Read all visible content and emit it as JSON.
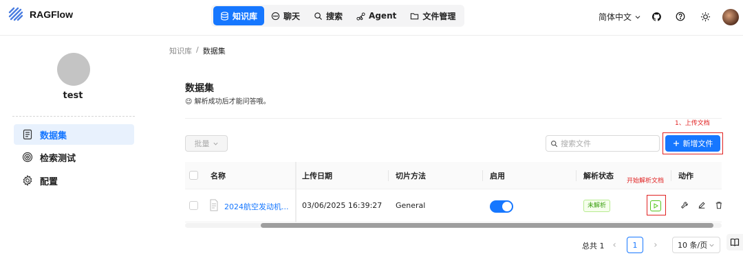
{
  "app": {
    "name": "RAGFlow"
  },
  "nav": {
    "items": [
      {
        "label": "知识库",
        "icon": "database-icon",
        "active": true
      },
      {
        "label": "聊天",
        "icon": "chat-icon",
        "active": false
      },
      {
        "label": "搜索",
        "icon": "search-icon",
        "active": false
      },
      {
        "label": "Agent",
        "icon": "agent-graph-icon",
        "active": false
      },
      {
        "label": "文件管理",
        "icon": "folder-icon",
        "active": false
      }
    ]
  },
  "header": {
    "language": "简体中文"
  },
  "profile": {
    "name": "test"
  },
  "sidebar": {
    "items": [
      {
        "label": "数据集",
        "icon": "document-icon",
        "active": true
      },
      {
        "label": "检索测试",
        "icon": "target-icon",
        "active": false
      },
      {
        "label": "配置",
        "icon": "gear-icon",
        "active": false
      }
    ]
  },
  "breadcrumb": {
    "root": "知识库",
    "separator": "/",
    "current": "数据集"
  },
  "page": {
    "title": "数据集",
    "description": "😉 解析成功后才能问答哦。"
  },
  "toolbar": {
    "batch_label": "批量",
    "search_placeholder": "搜索文件",
    "add_label": "新增文件",
    "upload_hint": "1、上传文档"
  },
  "table": {
    "columns": {
      "name": "名称",
      "upload_date": "上传日期",
      "chunk_method": "切片方法",
      "enabled": "启用",
      "parse_status": "解析状态",
      "actions": "动作"
    },
    "rows": [
      {
        "name": "2024航空发动机...",
        "upload_date": "03/06/2025 16:39:27",
        "chunk_method": "General",
        "enabled": true,
        "parse_status": "未解析"
      }
    ],
    "parse_hint": "开始解析文档"
  },
  "pagination": {
    "total_text": "总共 1",
    "current_page": "1",
    "page_size": "10 条/页"
  },
  "colors": {
    "accent": "#1677ff",
    "annotation": "#e02020",
    "status_green": "#389e0d"
  }
}
